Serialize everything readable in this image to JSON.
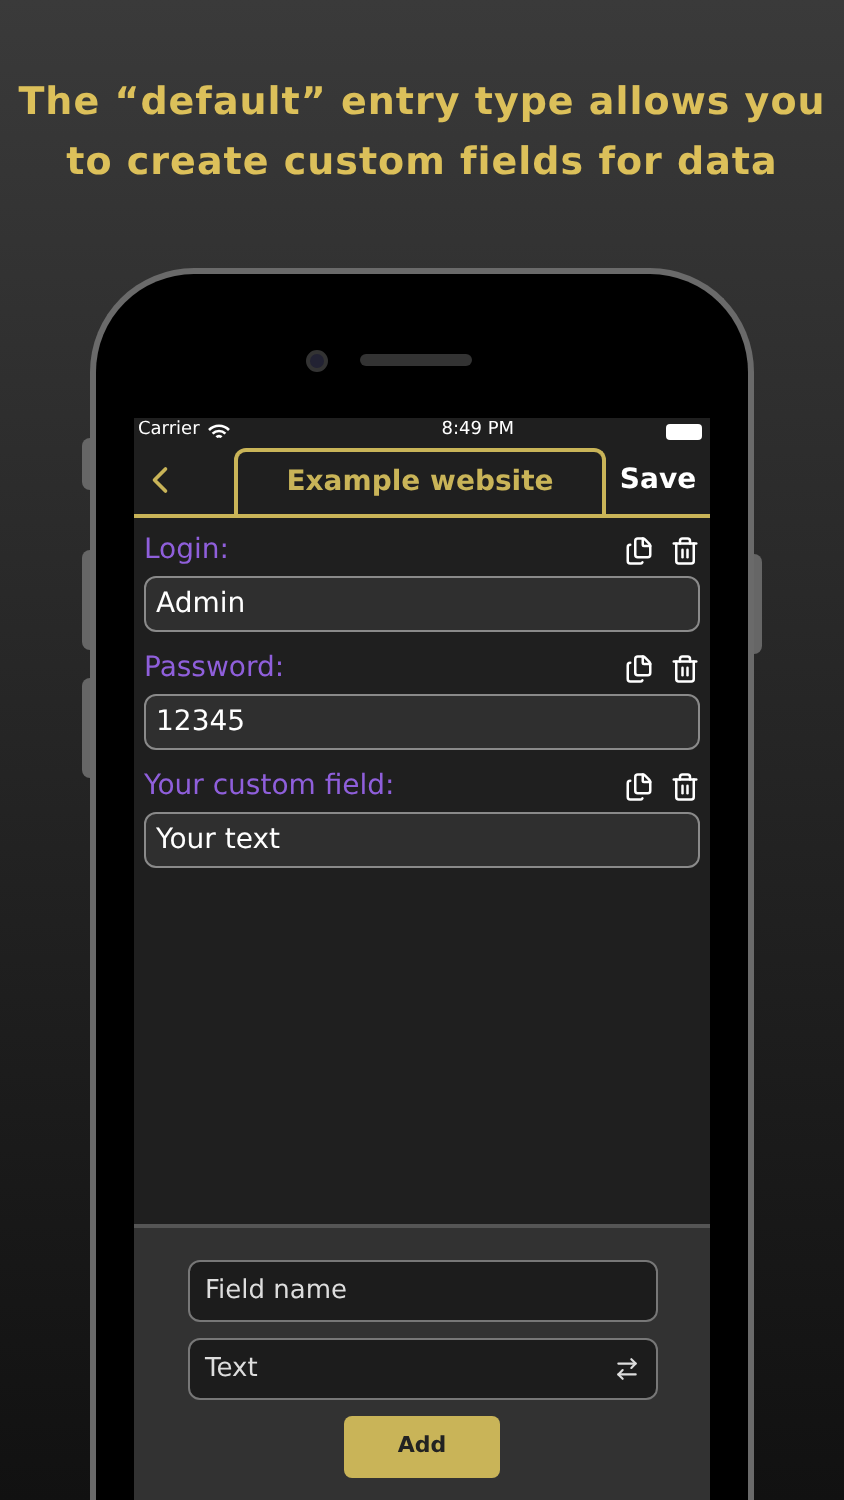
{
  "headline": "The “default” entry type allows you to create custom fields for data",
  "status_bar": {
    "carrier": "Carrier",
    "time": "8:49 PM"
  },
  "nav_bar": {
    "title": "Example website",
    "save": "Save"
  },
  "fields": [
    {
      "label": "Login:",
      "value": "Admin"
    },
    {
      "label": "Password:",
      "value": "12345"
    },
    {
      "label": "Your custom field:",
      "value": "Your text"
    }
  ],
  "add_panel": {
    "name_placeholder": "Field name",
    "type_value": "Text",
    "add_button": "Add"
  }
}
